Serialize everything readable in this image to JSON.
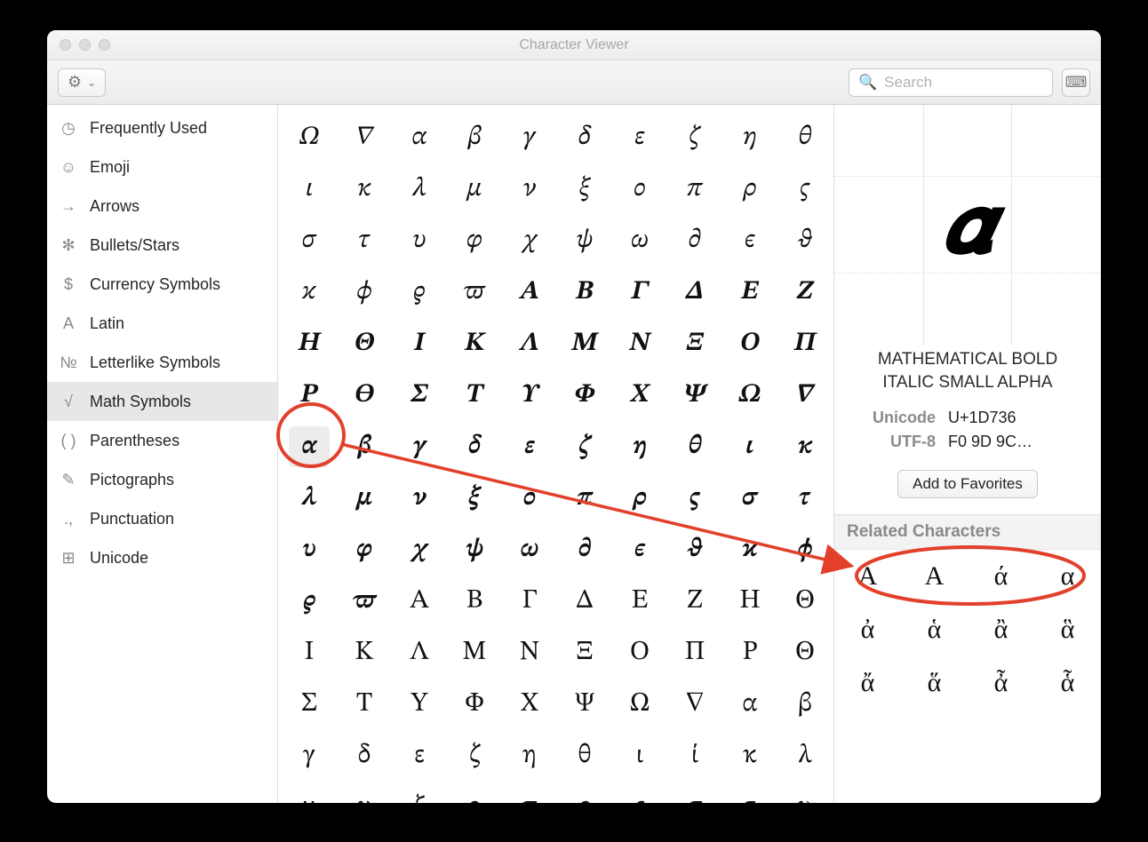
{
  "window": {
    "title": "Character Viewer"
  },
  "toolbar": {
    "search_placeholder": "Search",
    "gear_icon": "⚙",
    "chevron": "⌄"
  },
  "sidebar": {
    "items": [
      {
        "icon": "◷",
        "label": "Frequently Used"
      },
      {
        "icon": "☺",
        "label": "Emoji"
      },
      {
        "icon": "→",
        "label": "Arrows"
      },
      {
        "icon": "✻",
        "label": "Bullets/Stars"
      },
      {
        "icon": "$",
        "label": "Currency Symbols"
      },
      {
        "icon": "A",
        "label": "Latin"
      },
      {
        "icon": "№",
        "label": "Letterlike Symbols"
      },
      {
        "icon": "√",
        "label": "Math Symbols"
      },
      {
        "icon": "( )",
        "label": "Parentheses"
      },
      {
        "icon": "✎",
        "label": "Pictographs"
      },
      {
        "icon": ".,",
        "label": "Punctuation"
      },
      {
        "icon": "⊞",
        "label": "Unicode"
      }
    ],
    "selected_index": 7
  },
  "grid": {
    "selected_index": 60,
    "chars": [
      "𝛺",
      "𝛻",
      "𝛼",
      "𝛽",
      "𝛾",
      "𝛿",
      "𝜀",
      "𝜁",
      "𝜂",
      "𝜃",
      "𝜄",
      "𝜅",
      "𝜆",
      "𝜇",
      "𝜈",
      "𝜉",
      "𝜊",
      "𝜋",
      "𝜌",
      "𝜍",
      "𝜎",
      "𝜏",
      "𝜐",
      "𝜑",
      "𝜒",
      "𝜓",
      "𝜔",
      "𝜕",
      "𝜖",
      "𝜗",
      "𝜘",
      "𝜙",
      "𝜚",
      "𝜛",
      "𝜜",
      "𝜝",
      "𝜞",
      "𝜟",
      "𝜠",
      "𝜡",
      "𝜢",
      "𝜣",
      "𝜤",
      "𝜥",
      "𝜦",
      "𝜧",
      "𝜨",
      "𝜩",
      "𝜪",
      "𝜫",
      "𝜬",
      "𝜭",
      "𝜮",
      "𝜯",
      "𝜰",
      "𝜱",
      "𝜲",
      "𝜳",
      "𝜴",
      "𝜵",
      "𝜶",
      "𝜷",
      "𝜸",
      "𝜹",
      "𝜺",
      "𝜻",
      "𝜼",
      "𝜽",
      "𝜾",
      "𝜿",
      "𝝀",
      "𝝁",
      "𝝂",
      "𝝃",
      "𝝄",
      "𝝅",
      "𝝆",
      "𝝇",
      "𝝈",
      "𝝉",
      "𝝊",
      "𝝋",
      "𝝌",
      "𝝍",
      "𝝎",
      "𝝏",
      "𝝐",
      "𝝑",
      "𝝒",
      "𝝓",
      "𝝔",
      "𝝕",
      "Α",
      "Β",
      "Γ",
      "Δ",
      "Ε",
      "Ζ",
      "Η",
      "Θ",
      "Ι",
      "Κ",
      "Λ",
      "Μ",
      "Ν",
      "Ξ",
      "Ο",
      "Π",
      "Ρ",
      "Θ",
      "Σ",
      "Τ",
      "Υ",
      "Φ",
      "Χ",
      "Ψ",
      "Ω",
      "∇",
      "α",
      "β",
      "γ",
      "δ",
      "ε",
      "ζ",
      "η",
      "θ",
      "ι",
      "ί",
      "κ",
      "λ",
      "μ",
      "ν",
      "ξ",
      "ο",
      "π",
      "ρ",
      "ς",
      "σ",
      "τ",
      "υ"
    ]
  },
  "detail": {
    "glyph": "𝜶",
    "name": "MATHEMATICAL BOLD ITALIC SMALL ALPHA",
    "meta": [
      {
        "label": "Unicode",
        "value": "U+1D736"
      },
      {
        "label": "UTF-8",
        "value": "F0 9D 9C…"
      }
    ],
    "favorites_label": "Add to Favorites",
    "related_header": "Related Characters",
    "related": [
      "Ά",
      "Α",
      "ά",
      "α",
      "ἀ",
      "ἁ",
      "ἂ",
      "ἃ",
      "ἄ",
      "ἅ",
      "ἆ",
      "ἇ"
    ]
  }
}
